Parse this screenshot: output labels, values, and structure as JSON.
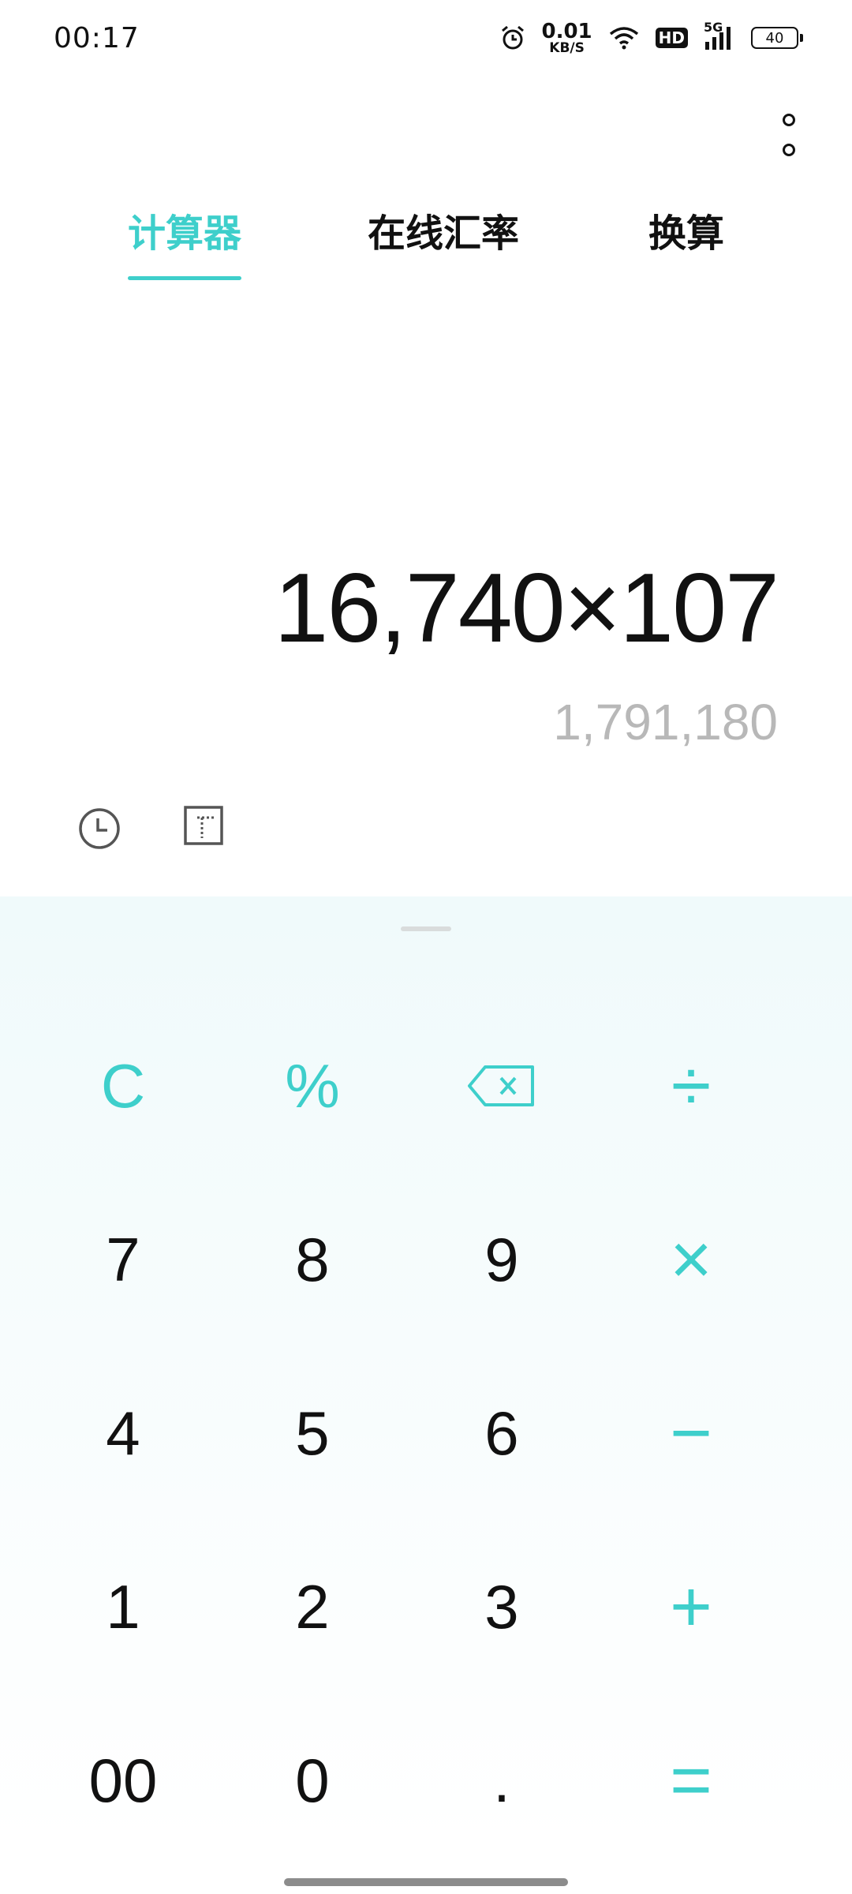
{
  "status_bar": {
    "time": "00:17",
    "net_speed_value": "0.01",
    "net_speed_unit": "KB/S",
    "hd_label": "HD",
    "network_label": "5G",
    "battery_level": "40",
    "icons": [
      "alarm-icon",
      "wifi-icon",
      "signal-icon",
      "battery-icon"
    ]
  },
  "tabs": [
    {
      "label": "计算器",
      "active": true
    },
    {
      "label": "在线汇率",
      "active": false
    },
    {
      "label": "换算",
      "active": false
    }
  ],
  "display": {
    "expression": "16,740×107",
    "result": "1,791,180"
  },
  "toolbar_icons": [
    "history-icon",
    "scientific-mode-icon"
  ],
  "keypad": {
    "rows": [
      [
        {
          "label": "C",
          "accent": true
        },
        {
          "label": "%",
          "accent": true
        },
        {
          "label": "",
          "icon": "backspace-icon",
          "accent": true
        },
        {
          "label": "÷",
          "accent": true
        }
      ],
      [
        {
          "label": "7"
        },
        {
          "label": "8"
        },
        {
          "label": "9"
        },
        {
          "label": "×",
          "accent": true
        }
      ],
      [
        {
          "label": "4"
        },
        {
          "label": "5"
        },
        {
          "label": "6"
        },
        {
          "label": "−",
          "accent": true
        }
      ],
      [
        {
          "label": "1"
        },
        {
          "label": "2"
        },
        {
          "label": "3"
        },
        {
          "label": "+",
          "accent": true
        }
      ],
      [
        {
          "label": "00"
        },
        {
          "label": "0"
        },
        {
          "label": "."
        },
        {
          "label": "=",
          "accent": true
        }
      ]
    ]
  },
  "colors": {
    "accent": "#3ecfcb",
    "keypad_bg": "#f0fafb",
    "result_text": "#b8b8b8"
  }
}
